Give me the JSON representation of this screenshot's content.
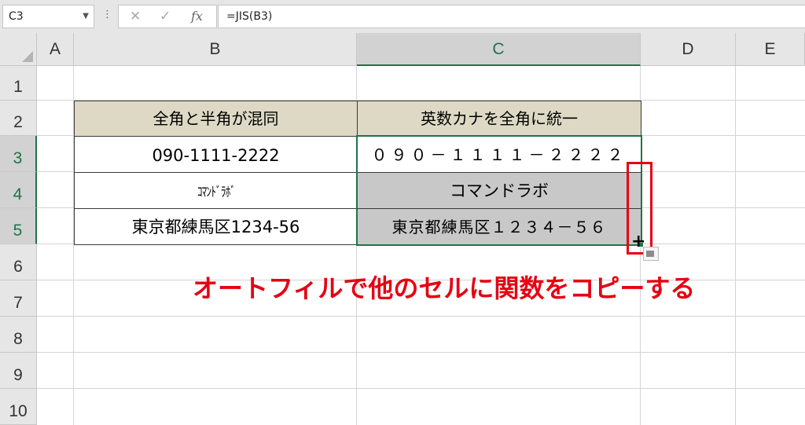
{
  "formula_bar": {
    "name_box": "C3",
    "cancel_symbol": "✕",
    "enter_symbol": "✓",
    "fx_label": "fx",
    "formula": "=JIS(B3)"
  },
  "columns": [
    "A",
    "B",
    "C",
    "D",
    "E"
  ],
  "rows": [
    "1",
    "2",
    "3",
    "4",
    "5",
    "6",
    "7",
    "8",
    "9",
    "10"
  ],
  "selected_column": "C",
  "selected_rows": [
    "3",
    "4",
    "5"
  ],
  "table": {
    "header_b": "全角と半角が混同",
    "header_c": "英数カナを全角に統一",
    "b3": "090-1111-2222",
    "c3": "０９０－１１１１－２２２２",
    "b4": "ｺﾏﾝﾄﾞﾗﾎﾞ",
    "c4": "コマンドラボ",
    "b5": "東京都練馬区1234-56",
    "c5": "東京都練馬区１２３４－５６"
  },
  "annotation": "オートフィルで他のセルに関数をコピーする",
  "colors": {
    "header_fill": "#ddd9c4",
    "selection_green": "#217346",
    "annotation_red": "#e60012",
    "filled_gray": "#c8c8c8"
  },
  "icons": [
    "chevron-down-icon",
    "cancel-icon",
    "enter-icon",
    "fx-icon",
    "crosshair-cursor-icon",
    "autofill-options-icon"
  ]
}
